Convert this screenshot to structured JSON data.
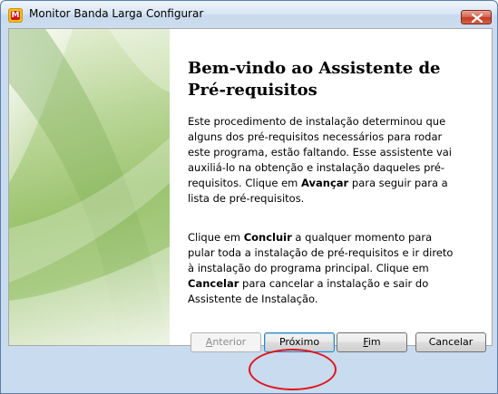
{
  "window": {
    "title": "Monitor Banda Larga Configurar",
    "app_icon_letter": "M"
  },
  "colors": {
    "highlight_ring": "#e2141d",
    "banner_green": "#9cc46f",
    "app_icon": "#f2c21a"
  },
  "wizard": {
    "heading": "Bem-vindo ao Assistente de Pré-requisitos",
    "paragraph1": {
      "before": "Este procedimento de instalação determinou que alguns dos pré-requisitos necessários para rodar este programa, estão faltando. Esse assistente vai auxiliá-lo na obtenção e instalação daqueles pré-requisitos. Clique em ",
      "bold": "Avançar",
      "after": " para seguir para a lista de pré-requisitos."
    },
    "paragraph2": {
      "before": "Clique em ",
      "bold1": "Concluir",
      "middle": " a qualquer momento para pular toda a instalação de pré-requisitos e ir direto à instalação do programa principal. Clique em ",
      "bold2": "Cancelar",
      "after": " para cancelar a instalação e sair do Assistente de Instalação."
    }
  },
  "buttons": {
    "back": {
      "mnemonic": "A",
      "rest": "nterior"
    },
    "next": "Próximo",
    "finish": {
      "mnemonic": "F",
      "rest": "im"
    },
    "cancel": "Cancelar"
  },
  "icons": {
    "close": "close-icon",
    "app": "app-icon"
  }
}
